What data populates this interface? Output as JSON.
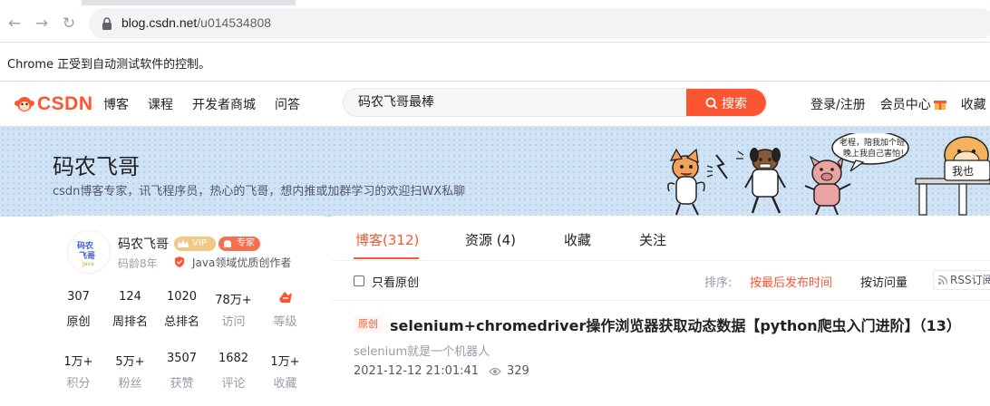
{
  "browser": {
    "url_host": "blog.csdn.net",
    "url_path": "/u014534808",
    "automation_notice": "Chrome 正受到自动测试软件的控制。"
  },
  "header": {
    "logo_text": "CSDN",
    "nav": [
      "博客",
      "课程",
      "开发者商城",
      "问答"
    ],
    "search_value": "码农飞哥最棒",
    "search_button": "搜索",
    "login": "登录/注册",
    "member_center": "会员中心",
    "favorites": "收藏"
  },
  "banner": {
    "title": "码农飞哥",
    "description": "csdn博客专家，讯飞程序员，热心的飞哥，想内推或加群学习的欢迎扫WX私聊",
    "speech_line1": "老程，陪我加个班",
    "speech_line2": "晚上我自己害怕！",
    "side_text": "我也"
  },
  "profile": {
    "avatar_line1": "码农",
    "avatar_line2": "飞哥",
    "avatar_line3": "Java",
    "nickname": "码农飞哥",
    "vip_label": "VIP",
    "expert_label": "专家",
    "code_age": "码龄8年",
    "creator_title": "Java领域优质创作者",
    "stats_row1": [
      {
        "value": "307",
        "label": "原创"
      },
      {
        "value": "124",
        "label": "周排名"
      },
      {
        "value": "1020",
        "label": "总排名"
      },
      {
        "value": "78万+",
        "label": "访问"
      },
      {
        "value": "",
        "label": "等级"
      }
    ],
    "stats_row2": [
      {
        "value": "1万+",
        "label": "积分"
      },
      {
        "value": "5万+",
        "label": "粉丝"
      },
      {
        "value": "3507",
        "label": "获赞"
      },
      {
        "value": "1682",
        "label": "评论"
      },
      {
        "value": "1万+",
        "label": "收藏"
      }
    ]
  },
  "content": {
    "tabs": [
      "博客(312)",
      "资源 (4)",
      "收藏",
      "关注"
    ],
    "only_original": "只看原创",
    "sort_label": "排序:",
    "sort_latest": "按最后发布时间",
    "sort_visits": "按访问量",
    "rss": "RSS订阅",
    "article": {
      "tag": "原创",
      "title": "selenium+chromedriver操作浏览器获取动态数据【python爬虫入门进阶】（13）",
      "description": "selenium就是一个机器人",
      "date": "2021-12-12 21:01:41",
      "views": "329"
    }
  },
  "colors": {
    "brand": "#fc5531",
    "banner_bg": "#cfe3f5"
  }
}
